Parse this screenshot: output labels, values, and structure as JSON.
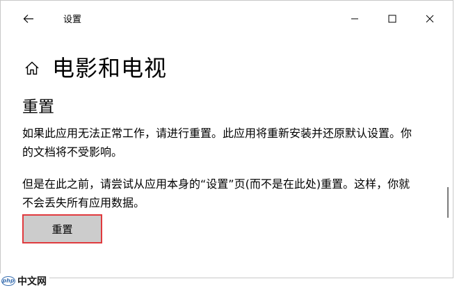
{
  "window": {
    "title": "设置",
    "controls": {
      "minimize": "minimize-icon",
      "maximize": "maximize-icon",
      "close": "close-icon"
    }
  },
  "header": {
    "home_icon": "home-icon",
    "title": "电影和电视"
  },
  "reset_section": {
    "heading": "重置",
    "description_1": "如果此应用无法正常工作，请进行重置。此应用将重新安装并还原默认设置。你的文档将不受影响。",
    "description_2": "但是在此之前，请尝试从应用本身的“设置”页(而不是在此处)重置。这样，你就不会丢失所有应用数据。",
    "button_label": "重置"
  },
  "watermark": {
    "logo_text": "php",
    "text": "中文网"
  },
  "colors": {
    "highlight_border": "#e03a3e",
    "button_bg": "#cccccc",
    "scrollbar": "#7a7a7a"
  }
}
